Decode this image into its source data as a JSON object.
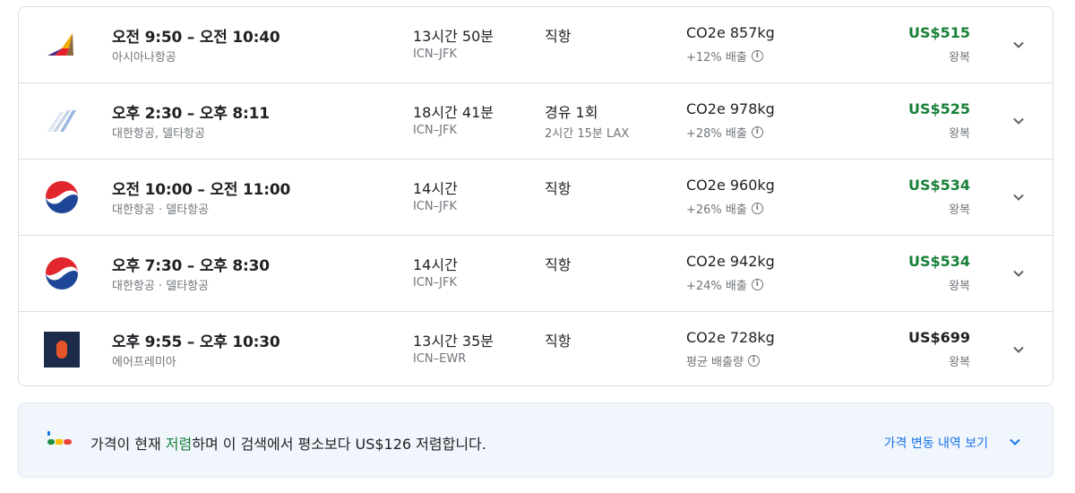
{
  "flights": [
    {
      "times": "오전 9:50 – 오전 10:40",
      "airline": "아시아나항공",
      "duration": "13시간 50분",
      "route": "ICN–JFK",
      "stops": "직항",
      "stop_detail": "",
      "co2": "CO2e 857kg",
      "co2_diff": "+12% 배출",
      "price": "US$515",
      "trip_type": "왕복",
      "price_color": "#188038",
      "logo": "asiana-logo-icon"
    },
    {
      "times": "오후 2:30 – 오후 8:11",
      "airline": "대한항공, 델타항공",
      "duration": "18시간 41분",
      "route": "ICN–JFK",
      "stops": "경유 1회",
      "stop_detail": "2시간 15분 LAX",
      "co2": "CO2e 978kg",
      "co2_diff": "+28% 배출",
      "price": "US$525",
      "trip_type": "왕복",
      "price_color": "#188038",
      "logo": "multi-airline-logo-icon"
    },
    {
      "times": "오전 10:00 – 오전 11:00",
      "airline": "대한항공 · 델타항공",
      "duration": "14시간",
      "route": "ICN–JFK",
      "stops": "직항",
      "stop_detail": "",
      "co2": "CO2e 960kg",
      "co2_diff": "+26% 배출",
      "price": "US$534",
      "trip_type": "왕복",
      "price_color": "#188038",
      "logo": "korean-air-logo-icon"
    },
    {
      "times": "오후 7:30 – 오후 8:30",
      "airline": "대한항공 · 델타항공",
      "duration": "14시간",
      "route": "ICN–JFK",
      "stops": "직항",
      "stop_detail": "",
      "co2": "CO2e 942kg",
      "co2_diff": "+24% 배출",
      "price": "US$534",
      "trip_type": "왕복",
      "price_color": "#188038",
      "logo": "korean-air-logo-icon"
    },
    {
      "times": "오후 9:55 – 오후 10:30",
      "airline": "에어프레미아",
      "duration": "13시간 35분",
      "route": "ICN–EWR",
      "stops": "직항",
      "stop_detail": "",
      "co2": "CO2e 728kg",
      "co2_diff": "평균 배출량",
      "price": "US$699",
      "trip_type": "왕복",
      "price_color": "#202124",
      "logo": "air-premia-logo-icon"
    }
  ],
  "insight": {
    "text_before": "가격이 현재 ",
    "highlight": "저렴",
    "text_after": "하며 이 검색에서 평소보다 US$126 저렴합니다.",
    "link": "가격 변동 내역 보기",
    "icon": "price-level-icon"
  },
  "icons": {
    "info": "info-icon",
    "chevron": "chevron-down-icon"
  }
}
